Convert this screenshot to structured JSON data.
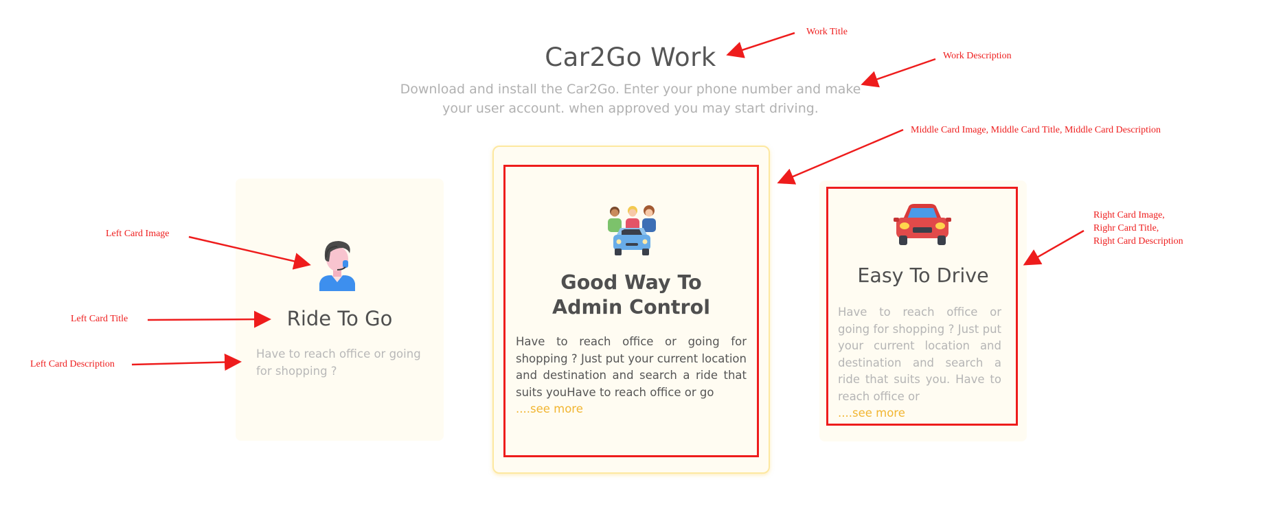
{
  "header": {
    "title": "Car2Go Work",
    "description": "Download and install the Car2Go. Enter your phone number and make your user account. when approved you may start driving."
  },
  "cards": {
    "left": {
      "image": "customer-support-agent-icon",
      "title": "Ride To Go",
      "description": "Have to reach office or going for shopping ?"
    },
    "middle": {
      "image": "people-with-taxi-icon",
      "title": "Good Way To Admin Control",
      "description": "Have to reach office or going for shopping ? Just put your current location and destination and search a ride that suits youHave to reach office or go",
      "see_more": "....see more"
    },
    "right": {
      "image": "red-car-icon",
      "title": "Easy To Drive",
      "description": "Have to reach office or going for shopping ? Just put your current location and destination and search a ride that suits you. Have to reach office or",
      "see_more": "....see more"
    }
  },
  "annotations": {
    "work_title": "Work Title",
    "work_description": "Work Description",
    "middle_card": "Middle Card Image, Middle Card Title, Middle Card Description",
    "right_card": "Right Card Image,\nRighr Card Title,\nRight Card Description",
    "left_card_image": "Left Card Image",
    "left_card_title": "Left Card Title",
    "left_card_description": "Left Card Description"
  },
  "colors": {
    "annotation_red": "#ee1c1c",
    "accent_yellow": "#f1b531",
    "card_background": "#fffcf2"
  }
}
